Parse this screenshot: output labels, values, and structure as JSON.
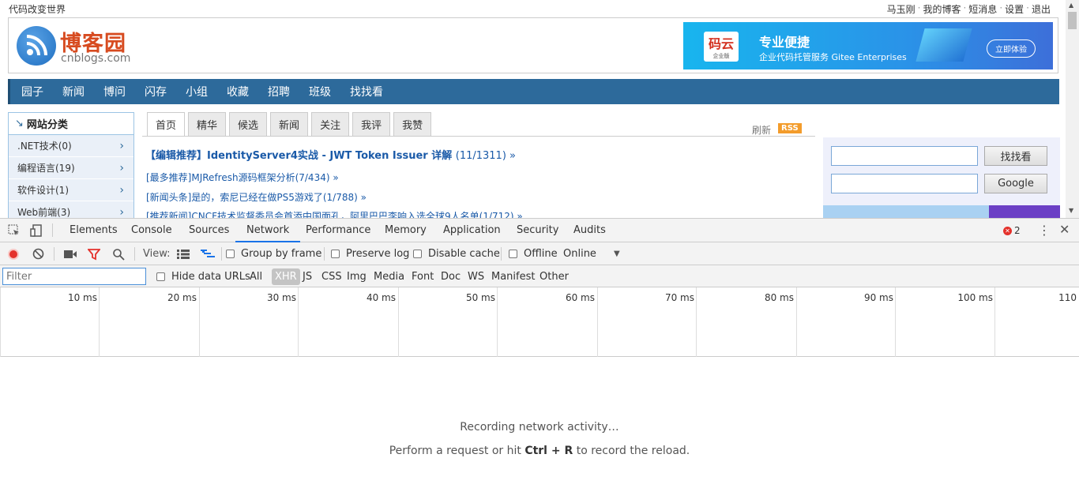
{
  "site": {
    "slogan": "代码改变世界",
    "user_links": [
      "马玉刚",
      "我的博客",
      "短消息",
      "设置",
      "退出"
    ],
    "logo_title": "博客园",
    "logo_sub": "cnblogs.com",
    "banner": {
      "brand": "码云",
      "brand_sub": "企业版",
      "headline": "专业便捷",
      "text": "企业代码托管服务 Gitee Enterprises",
      "pill": "立即体验"
    },
    "nav": [
      "园子",
      "新闻",
      "博问",
      "闪存",
      "小组",
      "收藏",
      "招聘",
      "班级",
      "找找看"
    ],
    "categories_title": "网站分类",
    "categories": [
      ".NET技术(0)",
      "编程语言(19)",
      "软件设计(1)",
      "Web前端(3)"
    ],
    "tabs": [
      "首页",
      "精华",
      "候选",
      "新闻",
      "关注",
      "我评",
      "我赞"
    ],
    "refresh": "刷新",
    "rss": "RSS",
    "headline": "【编辑推荐】IdentityServer4实战 - JWT Token Issuer 详解",
    "headline_count": "(11/1311) »",
    "posts": [
      "[最多推荐]MJRefresh源码框架分析(7/434) »",
      "[新闻头条]是的，索尼已经在做PS5游戏了(1/788) »",
      "[推荐新闻]CNCF技术监督委员会首添中国面孔，阿里巴巴李响入选全球9人名单(1/712) »"
    ],
    "search_btn": "找找看",
    "google_btn": "Google"
  },
  "devtools": {
    "tabs": [
      "Elements",
      "Console",
      "Sources",
      "Network",
      "Performance",
      "Memory",
      "Application",
      "Security",
      "Audits"
    ],
    "active_tab": "Network",
    "error_count": "2",
    "toolbar": {
      "view_label": "View:",
      "group_by_frame": "Group by frame",
      "preserve_log": "Preserve log",
      "disable_cache": "Disable cache",
      "offline": "Offline",
      "throttle": "Online"
    },
    "filter": {
      "placeholder": "Filter",
      "hide_data_urls": "Hide data URLs",
      "types": [
        "All",
        "XHR",
        "JS",
        "CSS",
        "Img",
        "Media",
        "Font",
        "Doc",
        "WS",
        "Manifest",
        "Other"
      ],
      "selected_type": "XHR"
    },
    "timeline_ticks": [
      "10 ms",
      "20 ms",
      "30 ms",
      "40 ms",
      "50 ms",
      "60 ms",
      "70 ms",
      "80 ms",
      "90 ms",
      "100 ms",
      "110"
    ],
    "empty_line1": "Recording network activity…",
    "empty_line2_pre": "Perform a request or hit",
    "empty_line2_keys": "Ctrl + R",
    "empty_line2_post": "to record the reload."
  }
}
